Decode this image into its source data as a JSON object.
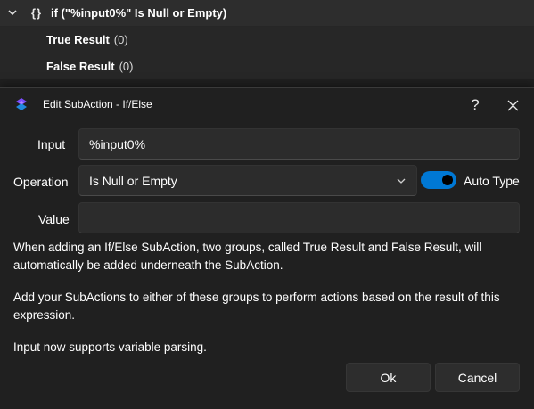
{
  "tree": {
    "node_braces": "{}",
    "node_title": "if (\"%input0%\" Is Null or Empty)",
    "children": [
      {
        "label": "True Result",
        "count": "(0)"
      },
      {
        "label": "False Result",
        "count": "(0)"
      }
    ]
  },
  "dialog": {
    "title": "Edit SubAction - If/Else",
    "help_label": "?",
    "close_label": "✕",
    "input_label": "Input",
    "input_value": "%input0%",
    "operation_label": "Operation",
    "operation_value": "Is Null or Empty",
    "auto_type_label": "Auto Type",
    "auto_type_on": true,
    "value_label": "Value",
    "value_value": "",
    "info_1": "When adding an If/Else SubAction, two groups, called True Result and False Result, will automatically be added underneath the SubAction.",
    "info_2": "Add your SubActions to either of these groups to perform actions based on the result of this expression.",
    "info_3": "Input now supports variable parsing.",
    "ok_label": "Ok",
    "cancel_label": "Cancel"
  },
  "colors": {
    "accent": "#0078d4",
    "background": "#202020",
    "control": "#2c2c2c"
  }
}
